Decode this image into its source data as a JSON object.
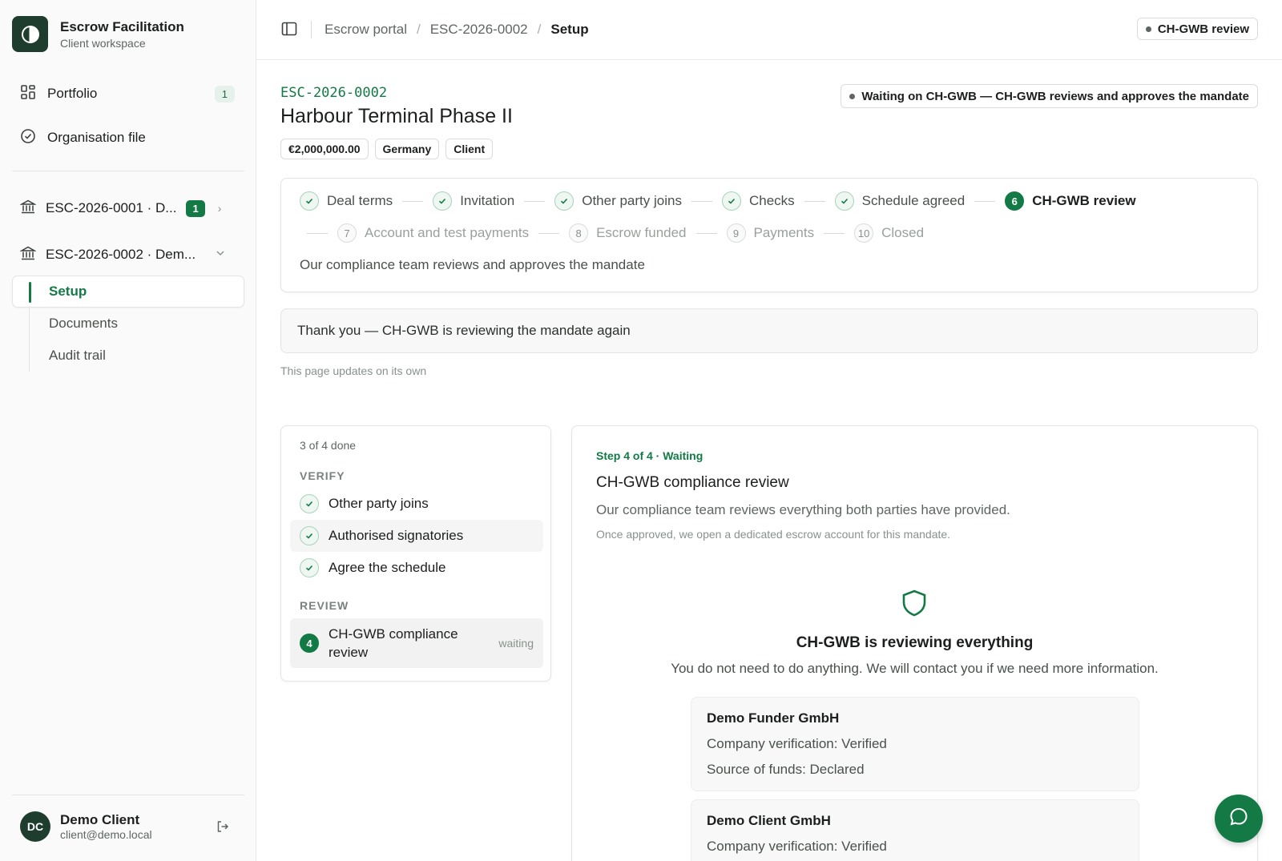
{
  "sidebar": {
    "brand_title": "Escrow Facilitation",
    "brand_sub": "Client workspace",
    "portfolio_label": "Portfolio",
    "portfolio_count": "1",
    "org_file_label": "Organisation file",
    "escrows": [
      {
        "label": "ESC-2026-0001 · D...",
        "count": "1"
      },
      {
        "label": "ESC-2026-0002 · Dem..."
      }
    ],
    "subnav": [
      "Setup",
      "Documents",
      "Audit trail"
    ],
    "user_initials": "DC",
    "user_name": "Demo Client",
    "user_email": "client@demo.local"
  },
  "header": {
    "breadcrumb": [
      "Escrow portal",
      "ESC-2026-0002",
      "Setup"
    ],
    "status_pill": "CH-GWB review"
  },
  "case": {
    "id": "ESC-2026-0002",
    "title": "Harbour Terminal Phase II",
    "tags": [
      "€2,000,000.00",
      "Germany",
      "Client"
    ],
    "waiting_pill": "Waiting on CH-GWB — CH-GWB reviews and approves the mandate"
  },
  "stepper": {
    "steps": [
      {
        "label": "Deal terms",
        "state": "done"
      },
      {
        "label": "Invitation",
        "state": "done"
      },
      {
        "label": "Other party joins",
        "state": "done"
      },
      {
        "label": "Checks",
        "state": "done"
      },
      {
        "label": "Schedule agreed",
        "state": "done"
      },
      {
        "num": "6",
        "label": "CH-GWB review",
        "state": "current"
      },
      {
        "num": "7",
        "label": "Account and test payments",
        "state": "todo"
      },
      {
        "num": "8",
        "label": "Escrow funded",
        "state": "todo"
      },
      {
        "num": "9",
        "label": "Payments",
        "state": "todo"
      },
      {
        "num": "10",
        "label": "Closed",
        "state": "todo"
      }
    ],
    "description": "Our compliance team reviews and approves the mandate"
  },
  "notice": "Thank you — CH-GWB is reviewing the mandate again",
  "updates_note": "This page updates on its own",
  "checklist": {
    "count": "3 of 4 done",
    "section_verify": "VERIFY",
    "verify_items": [
      "Other party joins",
      "Authorised signatories",
      "Agree the schedule"
    ],
    "section_review": "REVIEW",
    "review_num": "4",
    "review_item": "CH-GWB compliance review",
    "review_status": "waiting"
  },
  "detail": {
    "step_label": "Step 4 of 4 · Waiting",
    "title": "CH-GWB compliance review",
    "description": "Our compliance team reviews everything both parties have provided.",
    "note": "Once approved, we open a dedicated escrow account for this mandate.",
    "heading": "CH-GWB is reviewing everything",
    "subheading": "You do not need to do anything. We will contact you if we need more information.",
    "parties": [
      {
        "name": "Demo Funder GmbH",
        "lines": [
          "Company verification: Verified",
          "Source of funds: Declared"
        ]
      },
      {
        "name": "Demo Client GmbH",
        "lines": [
          "Company verification: Verified"
        ]
      }
    ]
  },
  "colors": {
    "accent": "#137a45",
    "brand_dark": "#1f3d2e"
  }
}
